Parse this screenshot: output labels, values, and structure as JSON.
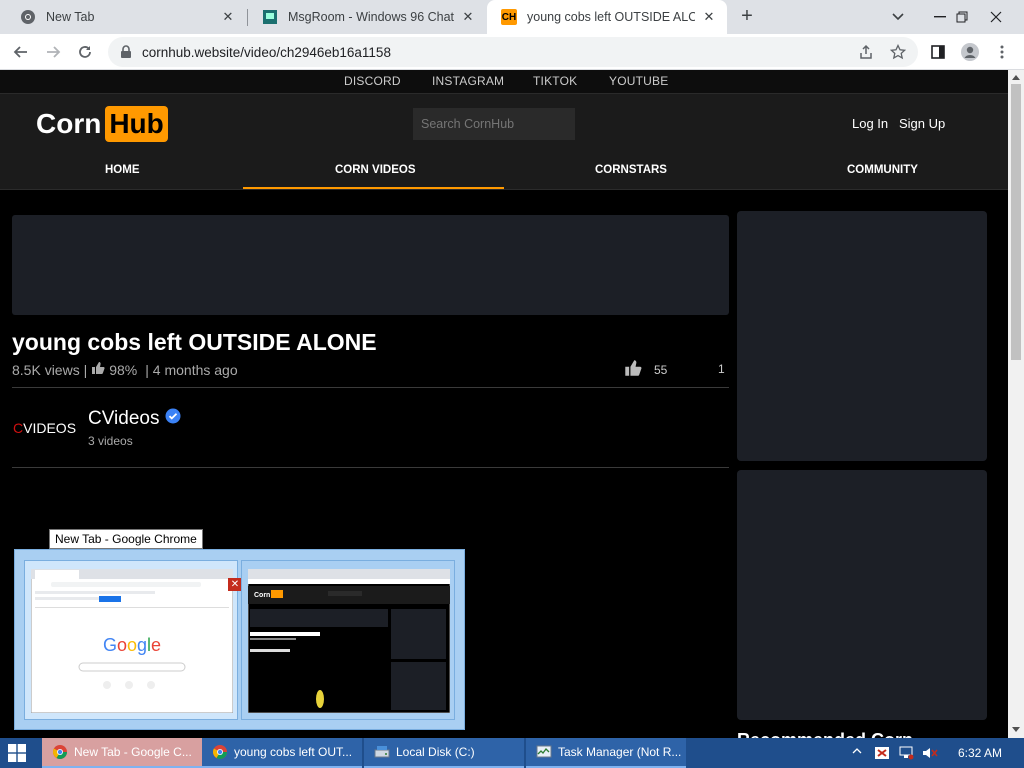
{
  "browser": {
    "tabs": [
      {
        "title": "New Tab"
      },
      {
        "title": "MsgRoom - Windows 96 Chat"
      },
      {
        "title": "young cobs left OUTSIDE ALONE",
        "favicon": "CH"
      }
    ],
    "url": "cornhub.website/video/ch2946eb16a1158"
  },
  "site": {
    "social": [
      "DISCORD",
      "INSTAGRAM",
      "TIKTOK",
      "YOUTUBE"
    ],
    "logo_left": "Corn",
    "logo_right": "Hub",
    "search_placeholder": "Search CornHub",
    "login": "Log In",
    "signup": "Sign Up",
    "nav": [
      "HOME",
      "CORN VIDEOS",
      "CORNSTARS",
      "COMMUNITY"
    ],
    "accent": "#ff9900"
  },
  "video": {
    "title": "young cobs left OUTSIDE ALONE",
    "views": "8.5K views |",
    "rating": "98%",
    "age": "| 4 months ago",
    "likes": "55",
    "dislikes": "1",
    "channel_logo_first": "C",
    "channel_logo_rest": "VIDEOS",
    "channel_name": "CVideos",
    "channel_count": "3 videos"
  },
  "sidebar": {
    "heading": "Recommended Corn"
  },
  "preview": {
    "tooltip": "New Tab - Google Chrome"
  },
  "taskbar": {
    "apps": [
      {
        "label": "New Tab - Google C..."
      },
      {
        "label": "young cobs left OUT..."
      },
      {
        "label": "Local Disk (C:)"
      },
      {
        "label": "Task Manager (Not R..."
      }
    ],
    "clock": "6:32 AM"
  }
}
